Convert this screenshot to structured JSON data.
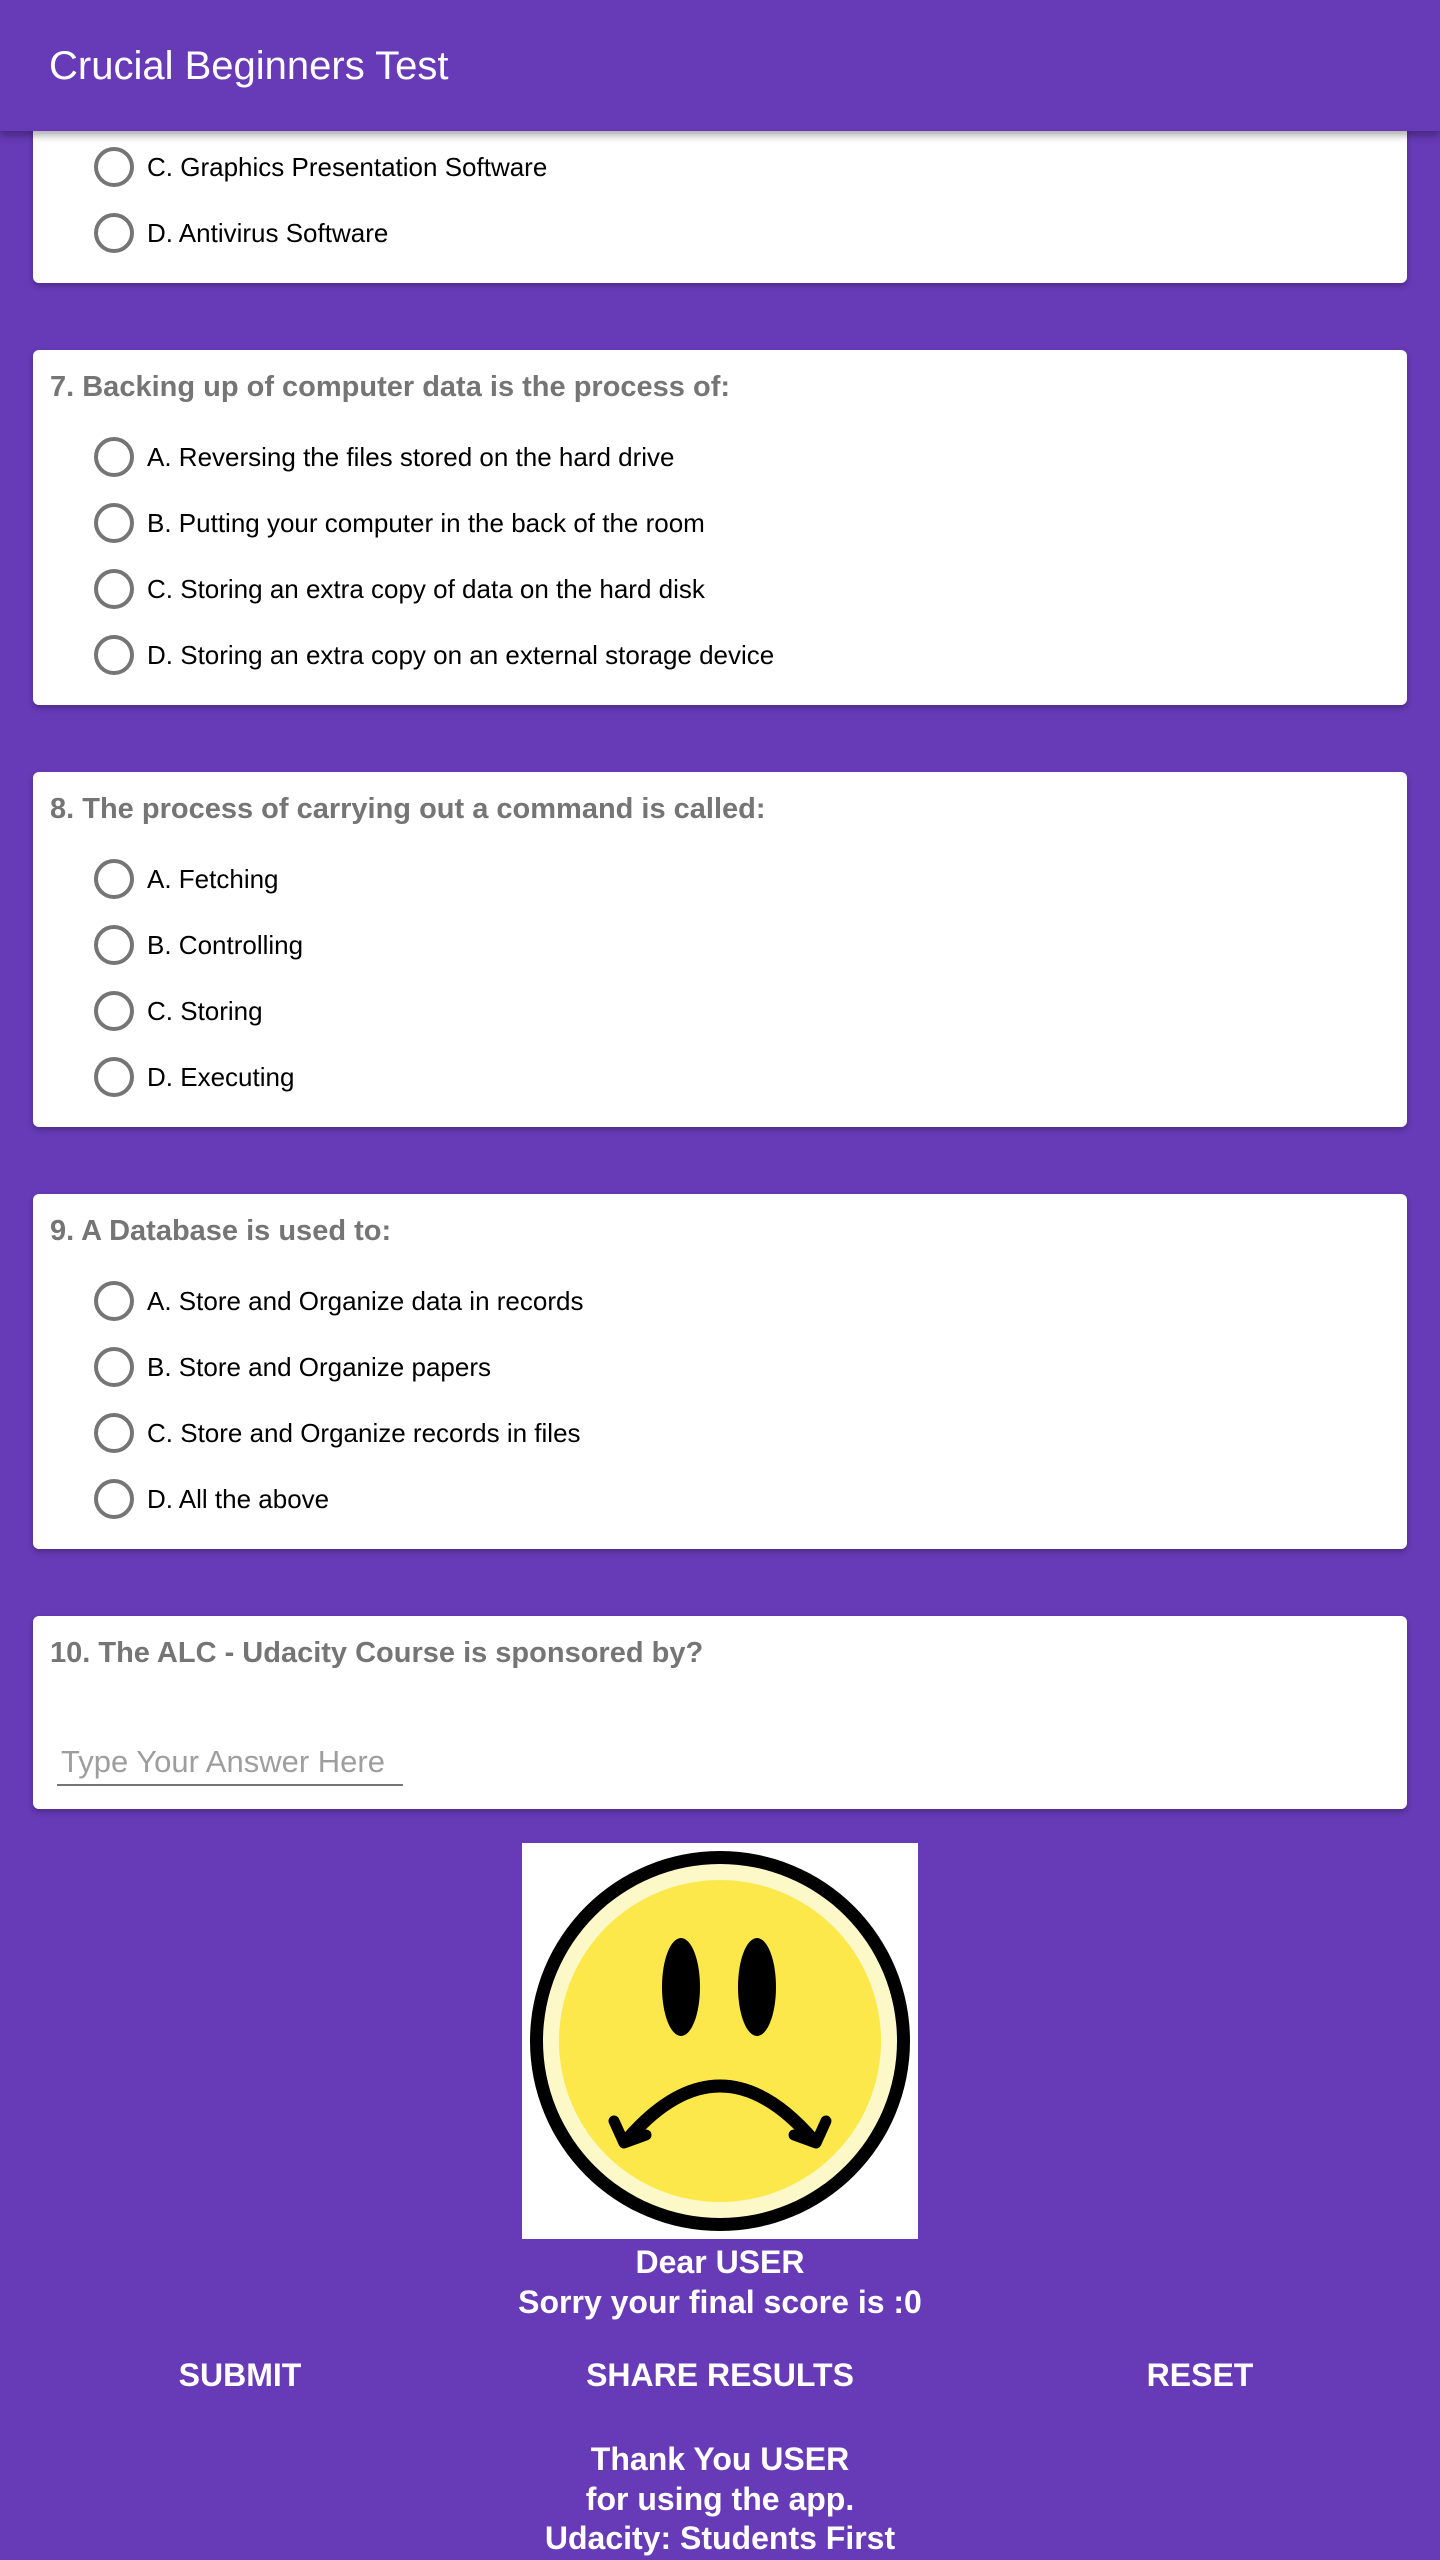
{
  "app_bar": {
    "title": "Crucial Beginners Test"
  },
  "questions": {
    "q6": {
      "options": [
        "C. Graphics Presentation Software",
        "D. Antivirus Software"
      ]
    },
    "q7": {
      "title": "7. Backing up of computer data is the process of:",
      "options": [
        "A. Reversing the files stored on the hard drive",
        "B. Putting your computer in the back of the room",
        "C. Storing an extra copy of data on the hard disk",
        "D. Storing an extra copy on an external storage device"
      ]
    },
    "q8": {
      "title": "8. The process of carrying out a command is called:",
      "options": [
        "A. Fetching",
        "B. Controlling",
        "C. Storing",
        "D. Executing"
      ]
    },
    "q9": {
      "title": "9. A Database is used to:",
      "options": [
        "A. Store and Organize data in records",
        "B. Store and Organize papers",
        "C. Store and Organize records in files",
        "D. All the above"
      ]
    },
    "q10": {
      "title": "10. The ALC - Udacity Course is sponsored by?",
      "answer_value": "",
      "answer_placeholder": "Type Your Answer Here"
    }
  },
  "result": {
    "image_icon": "sad-face-icon",
    "greeting": "Dear USER",
    "score_text": "Sorry your final score is :0"
  },
  "actions": {
    "submit_label": "SUBMIT",
    "share_label": "SHARE RESULTS",
    "reset_label": "RESET"
  },
  "footer": {
    "line1": "Thank You USER",
    "line2": "for using the app.",
    "line3": "Udacity: Students First"
  },
  "colors": {
    "primary": "#673ab7",
    "card": "#ffffff",
    "question_text": "#757575",
    "radio_outline": "#757575"
  }
}
